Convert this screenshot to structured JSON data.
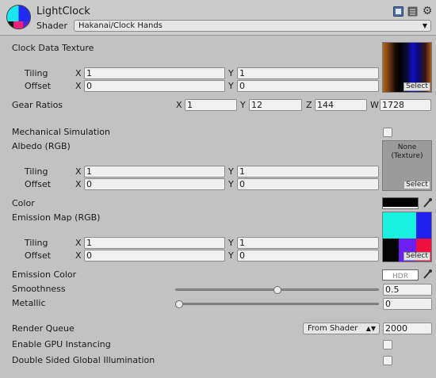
{
  "header": {
    "title": "LightClock",
    "shader_label": "Shader",
    "shader_value": "Hakanai/Clock Hands"
  },
  "clock_data_texture": {
    "label": "Clock Data Texture",
    "tiling_label": "Tiling",
    "offset_label": "Offset",
    "tiling_x": "1",
    "tiling_y": "1",
    "offset_x": "0",
    "offset_y": "0",
    "select_label": "Select"
  },
  "gear_ratios": {
    "label": "Gear Ratios",
    "x": "1",
    "y": "12",
    "z": "144",
    "w": "1728"
  },
  "mechanical_simulation": {
    "label": "Mechanical Simulation",
    "checked": false
  },
  "albedo": {
    "label": "Albedo (RGB)",
    "none_texture_label": "None\n(Texture)",
    "tiling_label": "Tiling",
    "offset_label": "Offset",
    "tiling_x": "1",
    "tiling_y": "1",
    "offset_x": "0",
    "offset_y": "0",
    "select_label": "Select"
  },
  "color": {
    "label": "Color",
    "swatch": "#000000"
  },
  "emission_map": {
    "label": "Emission Map (RGB)",
    "tiling_label": "Tiling",
    "offset_label": "Offset",
    "tiling_x": "1",
    "tiling_y": "1",
    "offset_x": "0",
    "offset_y": "0",
    "select_label": "Select"
  },
  "emission_color": {
    "label": "Emission Color",
    "hdr_label": "HDR"
  },
  "smoothness": {
    "label": "Smoothness",
    "value": "0.5",
    "fraction": 0.5
  },
  "metallic": {
    "label": "Metallic",
    "value": "0",
    "fraction": 0
  },
  "render_queue": {
    "label": "Render Queue",
    "dropdown": "From Shader",
    "value": "2000"
  },
  "gpu_instancing": {
    "label": "Enable GPU Instancing",
    "checked": false
  },
  "double_sided_gi": {
    "label": "Double Sided Global Illumination",
    "checked": false
  },
  "axes": {
    "x": "X",
    "y": "Y",
    "z": "Z",
    "w": "W"
  },
  "icons": {
    "material_icon": "material-sphere-icon",
    "help": "book-help-icon",
    "settings": "sliders-settings-icon",
    "gear": "gear-icon",
    "eyedropper": "eyedropper-icon"
  }
}
